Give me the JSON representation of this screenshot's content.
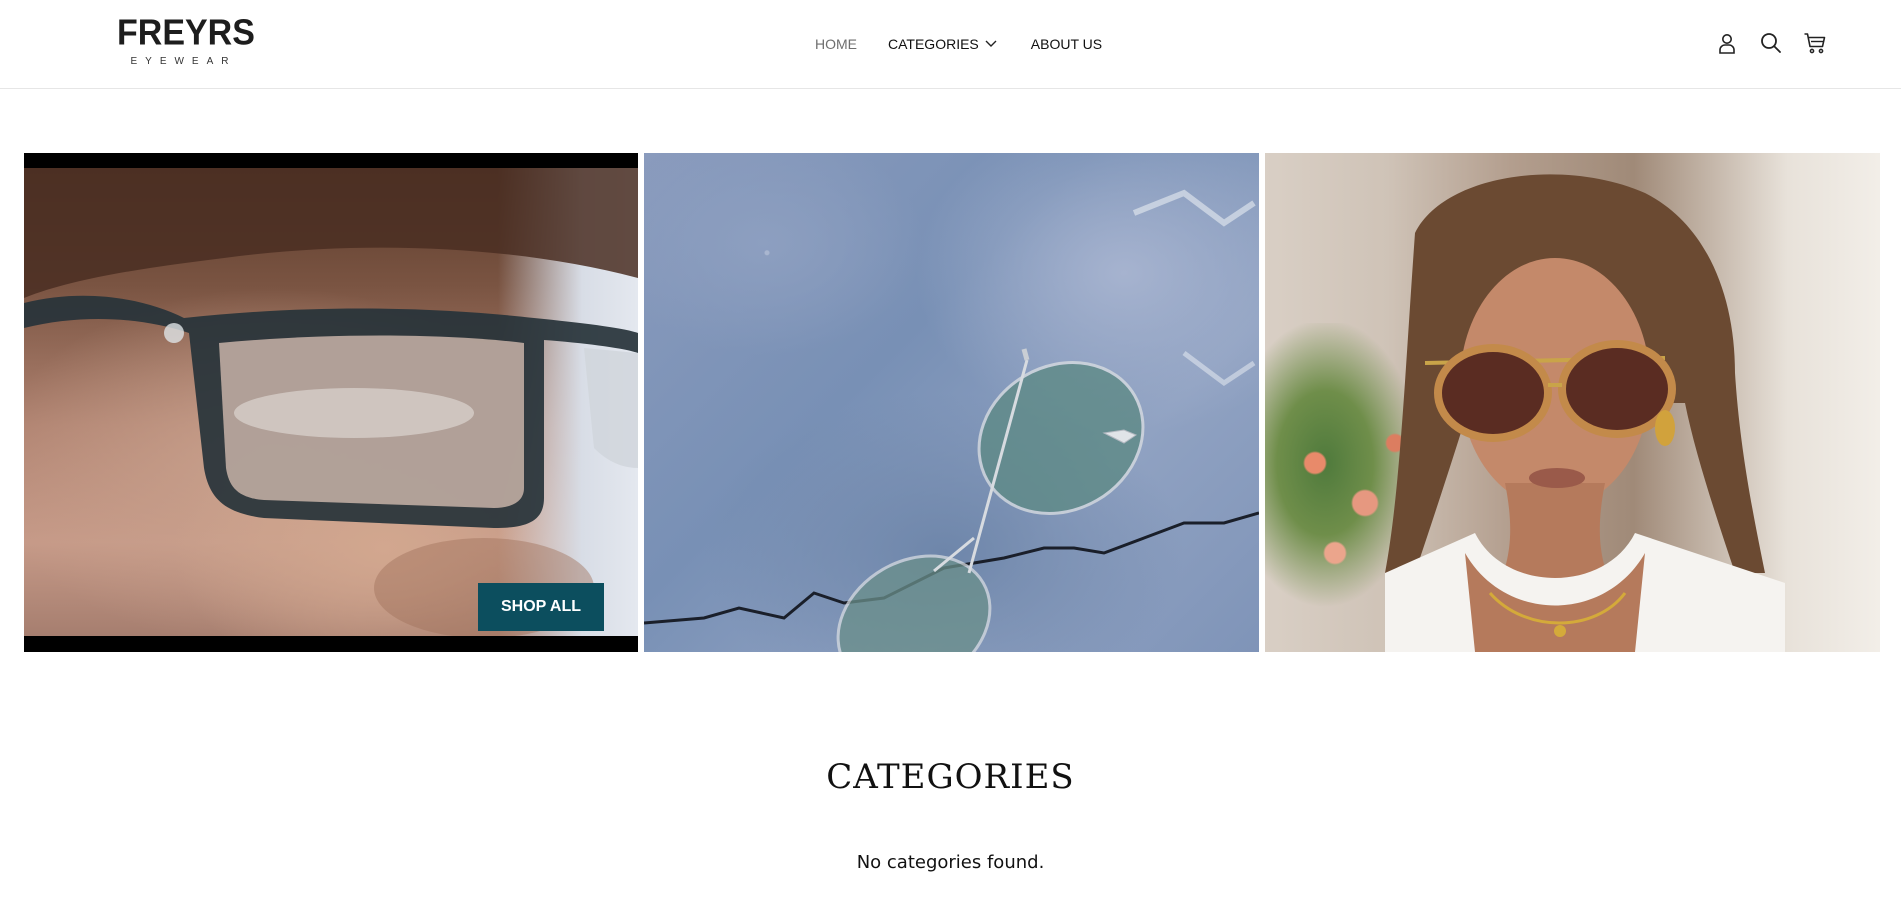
{
  "header": {
    "logo": {
      "main": "FREYRS",
      "sub": "EYEWEAR"
    },
    "nav": {
      "home": "HOME",
      "categories": "CATEGORIES",
      "about": "ABOUT US"
    },
    "icons": [
      "account-icon",
      "search-icon",
      "cart-icon"
    ]
  },
  "hero": {
    "tiles": [
      {
        "name": "close-up-glasses-photo"
      },
      {
        "name": "glasses-on-concrete-photo"
      },
      {
        "name": "woman-sunglasses-photo"
      }
    ],
    "shop_all_label": "SHOP ALL"
  },
  "categories": {
    "title": "CATEGORIES",
    "empty_message": "No categories found."
  },
  "colors": {
    "accent": "#0c4e5e",
    "nav_active": "#6e6e6e",
    "border": "#e6e6e6"
  }
}
